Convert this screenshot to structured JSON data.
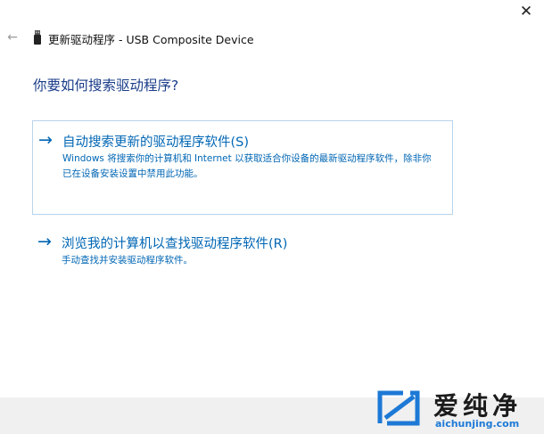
{
  "window": {
    "close_glyph": "✕",
    "title": "更新驱动程序 - USB Composite Device",
    "back_glyph": "←",
    "device_icon": "usb-device-icon"
  },
  "heading": "你要如何搜索驱动程序?",
  "options": [
    {
      "arrow": "→",
      "title": "自动搜索更新的驱动程序软件(S)",
      "description": "Windows 将搜索你的计算机和 Internet 以获取适合你设备的最新驱动程序软件，除非你已在设备安装设置中禁用此功能。",
      "selected": true
    },
    {
      "arrow": "→",
      "title": "浏览我的计算机以查找驱动程序软件(R)",
      "description": "手动查找并安装驱动程序软件。",
      "selected": false
    }
  ],
  "watermark": {
    "name": "爱纯净",
    "domain": "aichunjing.com"
  },
  "colors": {
    "accent": "#0066b4",
    "heading": "#1a3d8a",
    "selection_border": "#b8d4ec",
    "footer": "#f0f0f0",
    "watermark_blue": "#1d79d6"
  }
}
